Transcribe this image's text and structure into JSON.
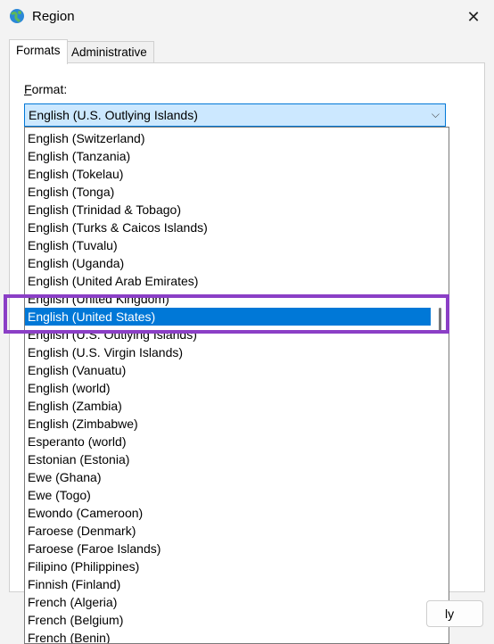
{
  "window": {
    "title": "Region",
    "close_glyph": "✕"
  },
  "tabs": [
    {
      "label": "Formats",
      "active": true
    },
    {
      "label": "Administrative",
      "active": false
    }
  ],
  "format": {
    "label_accel": "F",
    "label_rest": "ormat:",
    "selected_value": "English (U.S. Outlying Islands)",
    "arrow_glyph": "⌵"
  },
  "dropdown_items": [
    "English (Switzerland)",
    "English (Tanzania)",
    "English (Tokelau)",
    "English (Tonga)",
    "English (Trinidad & Tobago)",
    "English (Turks & Caicos Islands)",
    "English (Tuvalu)",
    "English (Uganda)",
    "English (United Arab Emirates)",
    "English (United Kingdom)",
    "English (United States)",
    "English (U.S. Outlying Islands)",
    "English (U.S. Virgin Islands)",
    "English (Vanuatu)",
    "English (world)",
    "English (Zambia)",
    "English (Zimbabwe)",
    "Esperanto (world)",
    "Estonian (Estonia)",
    "Ewe (Ghana)",
    "Ewe (Togo)",
    "Ewondo (Cameroon)",
    "Faroese (Denmark)",
    "Faroese (Faroe Islands)",
    "Filipino (Philippines)",
    "Finnish (Finland)",
    "French (Algeria)",
    "French (Belgium)",
    "French (Benin)"
  ],
  "selected_index": 10,
  "highlight_color": "#8b3fc6",
  "accent_color": "#0078d7",
  "buttons": {
    "apply_partial": "ly"
  }
}
